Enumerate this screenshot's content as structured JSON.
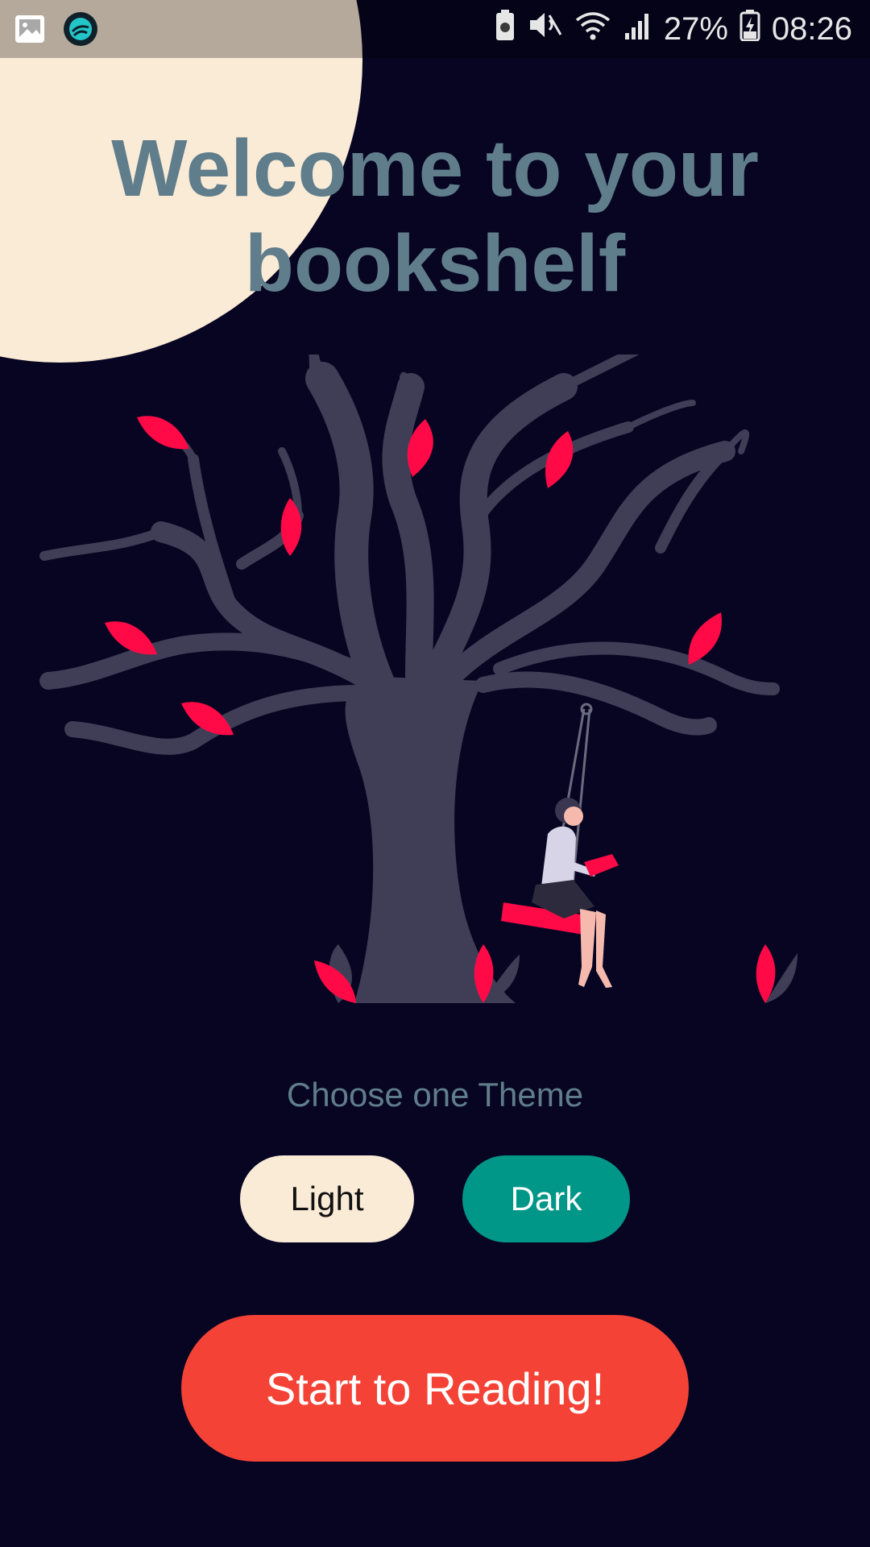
{
  "status_bar": {
    "battery_percent": "27%",
    "time": "08:26",
    "icons": [
      "gallery-icon",
      "app-notification-icon",
      "battery-saver-icon",
      "mute-icon",
      "wifi-icon",
      "signal-icon",
      "battery-charging-icon"
    ]
  },
  "header": {
    "title_line1": "Welcome to your",
    "title_line2": "bookshelf"
  },
  "illustration": {
    "subject": "tree-with-reader-on-swing"
  },
  "theme": {
    "label": "Choose one Theme",
    "options": [
      "Light",
      "Dark"
    ],
    "selected": "Dark"
  },
  "cta": {
    "label": "Start to Reading!"
  },
  "colors": {
    "background": "#070522",
    "moon": "#faebd7",
    "title": "#607d8b",
    "leaf": "#ff0a47",
    "tree": "#403e56",
    "light_button": "#faebd7",
    "dark_button": "#009688",
    "cta_button": "#f44336"
  }
}
